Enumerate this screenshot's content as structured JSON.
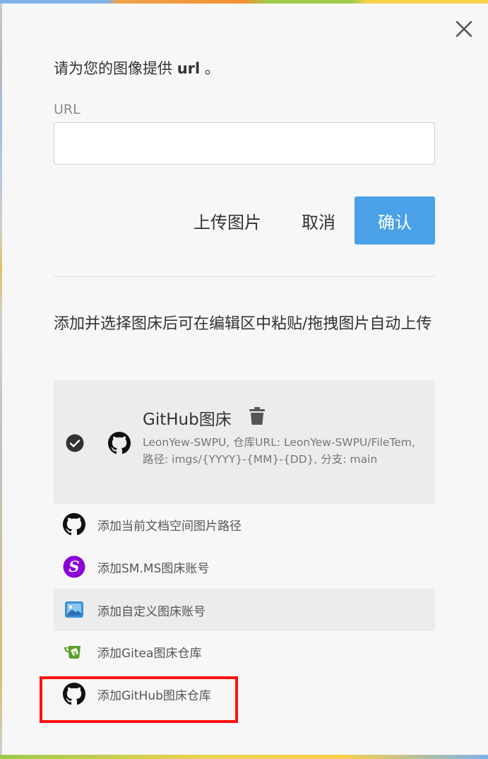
{
  "dialog": {
    "heading_prefix": "请为您的图像提供",
    "heading_bold": "url",
    "heading_suffix": "。",
    "url_label": "URL",
    "url_value": "",
    "upload_label": "上传图片",
    "cancel_label": "取消",
    "confirm_label": "确认",
    "hint": "添加并选择图床后可在编辑区中粘贴/拖拽图片自动上传"
  },
  "selected_bed": {
    "title": "GitHub图床",
    "description": "LeonYew-SWPU, 仓库URL: LeonYew-SWPU/FileTem, 路径: imgs/{YYYY}-{MM}-{DD}, 分支: main"
  },
  "options": [
    {
      "label": "添加当前文档空间图片路径",
      "icon": "github-icon"
    },
    {
      "label": "添加SM.MS图床账号",
      "icon": "smms-icon"
    },
    {
      "label": "添加自定义图床账号",
      "icon": "custom-image-bed-icon"
    },
    {
      "label": "添加Gitea图床仓库",
      "icon": "gitea-icon"
    },
    {
      "label": "添加GitHub图床仓库",
      "icon": "github-icon"
    }
  ],
  "colors": {
    "accent": "#4aa1e8",
    "highlight": "#ff1010",
    "smms": "#8b00d9",
    "gitea": "#5aa02c"
  }
}
